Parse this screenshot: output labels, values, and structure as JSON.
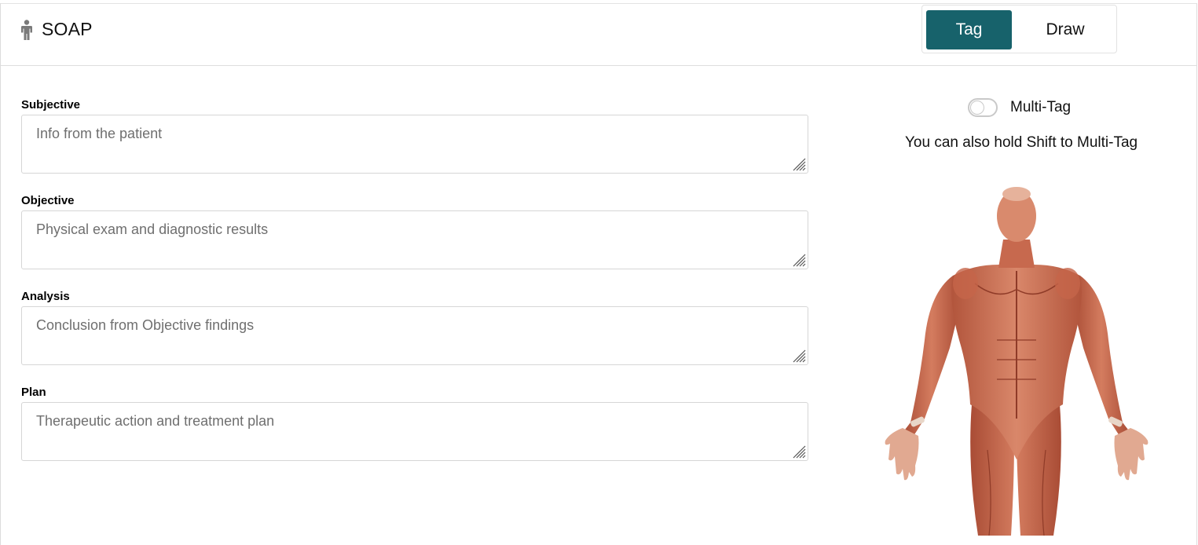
{
  "header": {
    "title": "SOAP",
    "icon": "person-icon",
    "modes": [
      {
        "label": "Tag",
        "active": true
      },
      {
        "label": "Draw",
        "active": false
      }
    ],
    "accent_color": "#17626b"
  },
  "fields": [
    {
      "label": "Subjective",
      "value": "",
      "placeholder": "Info from the patient"
    },
    {
      "label": "Objective",
      "value": "",
      "placeholder": "Physical exam and diagnostic results"
    },
    {
      "label": "Analysis",
      "value": "",
      "placeholder": "Conclusion from Objective findings"
    },
    {
      "label": "Plan",
      "value": "",
      "placeholder": "Therapeutic action and treatment plan"
    }
  ],
  "multitag": {
    "label": "Multi-Tag",
    "enabled": false,
    "hint": "You can also hold Shift to Multi-Tag"
  },
  "body_figure": {
    "icon": "anatomy-muscle-figure",
    "skin_color": "#c9634a"
  }
}
